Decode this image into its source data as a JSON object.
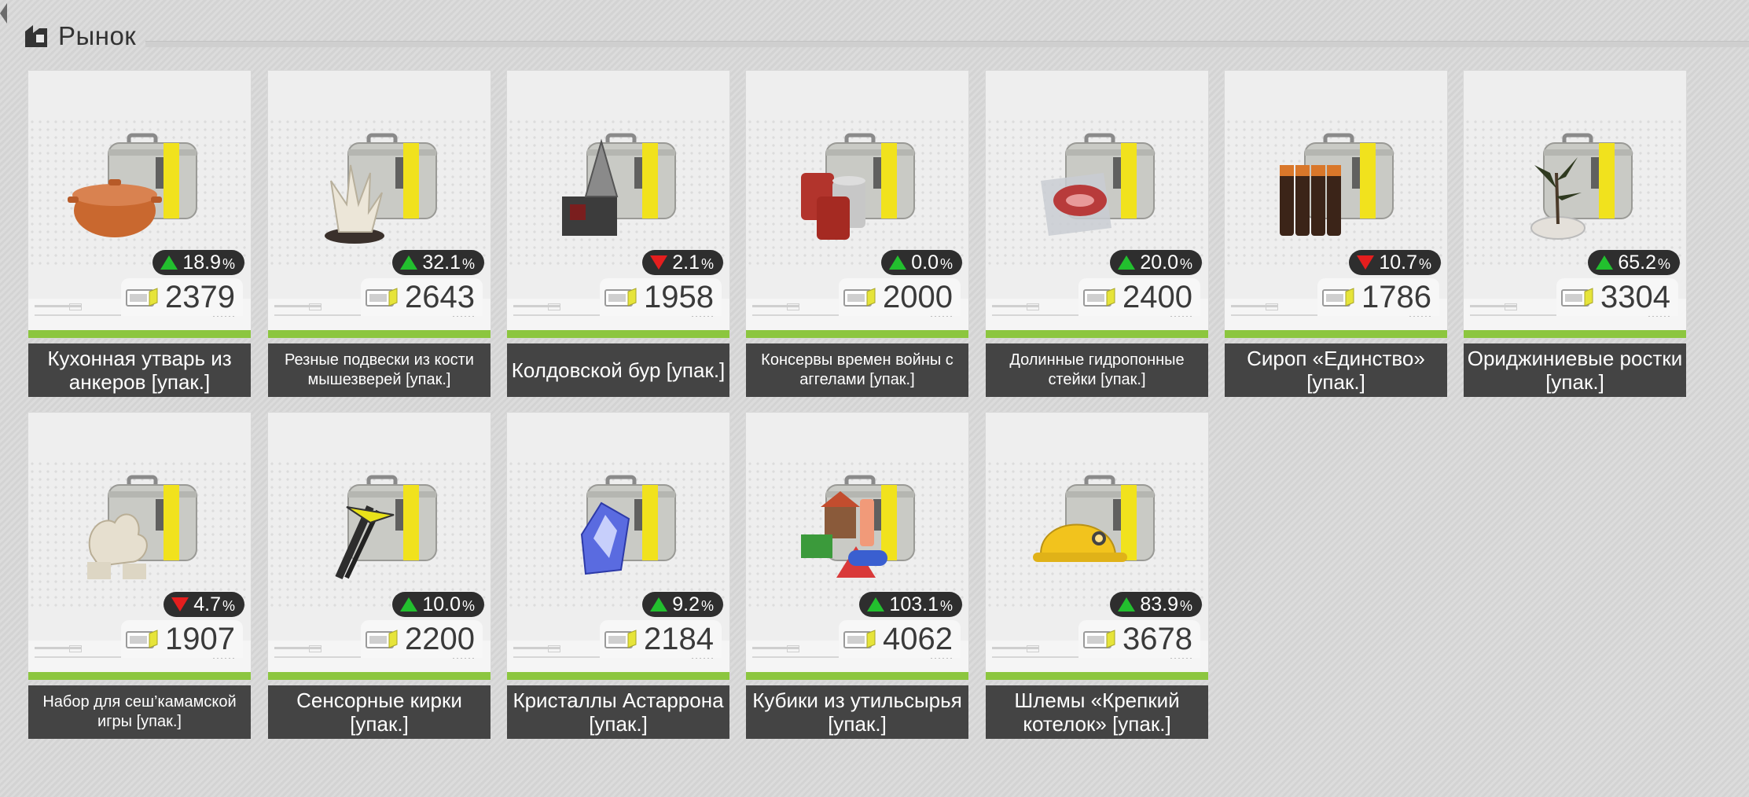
{
  "header": {
    "title": "Рынок",
    "icon": "market-icon"
  },
  "currency_icon": "ticket-coin-icon",
  "colors": {
    "up": "#22c02e",
    "down": "#e51e1e",
    "accent_bar": "#8cc63f",
    "label_bg": "#444444"
  },
  "items": [
    {
      "name": "Кухонная утварь из анкеров [упак.]",
      "change": "18.9",
      "pct": "%",
      "direction": "up",
      "price": "2379",
      "icon": "cooking-pot-icon"
    },
    {
      "name": "Резные подвески из кости мышезверей [упак.]",
      "change": "32.1",
      "pct": "%",
      "direction": "up",
      "price": "2643",
      "icon": "bone-carving-icon"
    },
    {
      "name": "Колдовской бур [упак.]",
      "change": "2.1",
      "pct": "%",
      "direction": "down",
      "price": "1958",
      "icon": "drill-icon"
    },
    {
      "name": "Консервы времен войны с аггелами [упак.]",
      "change": "0.0",
      "pct": "%",
      "direction": "up",
      "price": "2000",
      "icon": "canned-food-icon"
    },
    {
      "name": "Долинные гидропонные стейки [упак.]",
      "change": "20.0",
      "pct": "%",
      "direction": "up",
      "price": "2400",
      "icon": "steak-pack-icon"
    },
    {
      "name": "Сироп «Единство» [упак.]",
      "change": "10.7",
      "pct": "%",
      "direction": "down",
      "price": "1786",
      "icon": "syrup-bottles-icon"
    },
    {
      "name": "Ориджиниевые ростки [упак.]",
      "change": "65.2",
      "pct": "%",
      "direction": "up",
      "price": "3304",
      "icon": "sprout-pot-icon"
    },
    {
      "name": "Набор для сеш’камамской игры [упак.]",
      "change": "4.7",
      "pct": "%",
      "direction": "down",
      "price": "1907",
      "icon": "game-set-icon"
    },
    {
      "name": "Сенсорные кирки [упак.]",
      "change": "10.0",
      "pct": "%",
      "direction": "up",
      "price": "2200",
      "icon": "pickaxe-icon"
    },
    {
      "name": "Кристаллы Астаррона [упак.]",
      "change": "9.2",
      "pct": "%",
      "direction": "up",
      "price": "2184",
      "icon": "crystal-icon"
    },
    {
      "name": "Кубики из утильсырья [упак.]",
      "change": "103.1",
      "pct": "%",
      "direction": "up",
      "price": "4062",
      "icon": "toy-blocks-icon"
    },
    {
      "name": "Шлемы «Крепкий котелок» [упак.]",
      "change": "83.9",
      "pct": "%",
      "direction": "up",
      "price": "3678",
      "icon": "hard-hat-icon"
    }
  ]
}
